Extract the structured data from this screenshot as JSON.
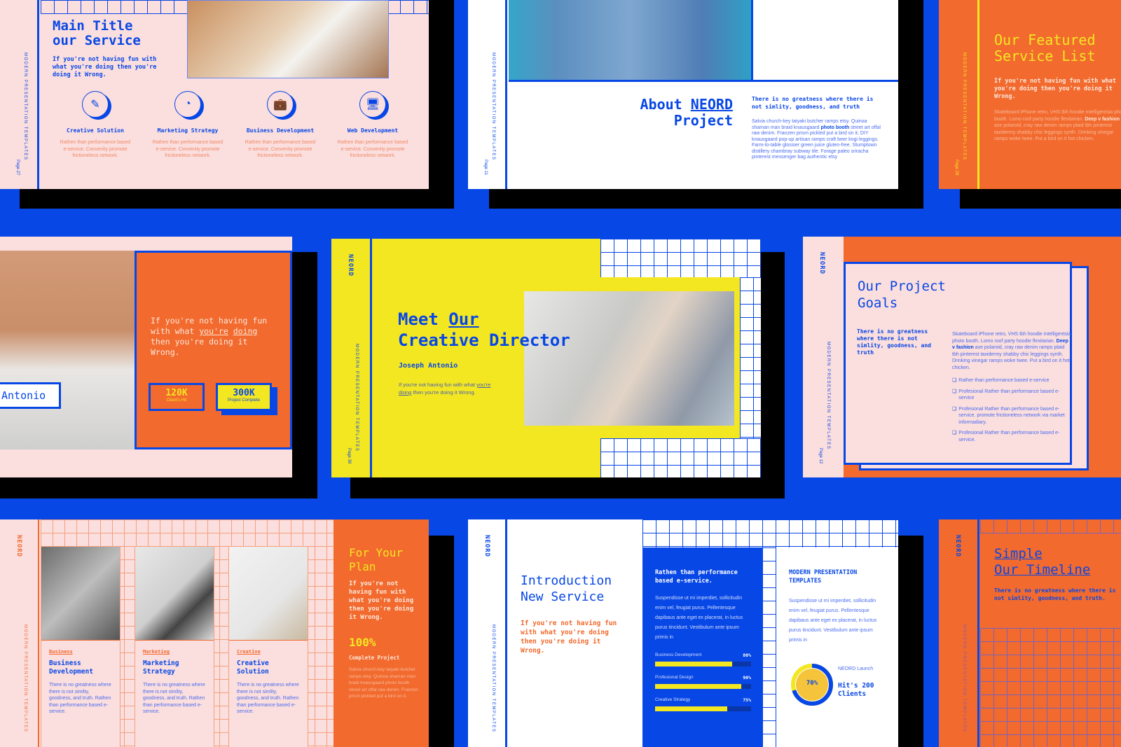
{
  "colors": {
    "blue": "#0747e6",
    "orange": "#f26a2e",
    "yellow": "#f3e722",
    "pink": "#fbdede",
    "white": "#ffffff"
  },
  "common": {
    "brand": "NEORD",
    "template": "MODERN PRESENTATION TEMPLATES"
  },
  "slide_service": {
    "title_1": "Main Title",
    "title_2": "our Service",
    "subtitle": "If you're not having fun with what you're doing then you're doing it Wrong.",
    "page": "Page 27",
    "services": [
      {
        "icon": "edit-icon",
        "glyph": "✎",
        "title": "Creative Solution",
        "text": "Rathen than performance based e-service. Convenity promote frictioneless network."
      },
      {
        "icon": "pie-chart-icon",
        "glyph": "◔",
        "title": "Marketing Strategy",
        "text": "Rathen than performance based e-service. Convenity promote frictioneless network."
      },
      {
        "icon": "briefcase-icon",
        "glyph": "💼",
        "title": "Business Development",
        "text": "Rathen than performance based e-service. Convenity promote frictioneless network."
      },
      {
        "icon": "monitor-icon",
        "glyph": "🖥",
        "title": "Web Development",
        "text": "Rathen than performance based e-service. Convenity promote frictioneless network."
      }
    ]
  },
  "slide_about": {
    "title_1": "About",
    "title_accent": "NEORD",
    "title_2": "Project",
    "page": "Page 11",
    "lead": "There is no greatness where there is not simlity, goodness, and truth",
    "body_1": "Salvia church-key taiyaki butcher ramps etsy. Quinoa shaman man braid knausgaard ",
    "body_bold": "photo booth",
    "body_2": " street art offal raw denim. Franzen prism pickled put a bird on it, DIY knausgaard pop-up artisan ramps craft beer kogi leggings. Farm-to-table glossier green juice gluten-free. Stumptown distillery chambray subway tile. Forage paleo sriracha pinterest messenger bag authentic etsy"
  },
  "slide_featured": {
    "title_1": "Our Featured",
    "title_2": "Service List",
    "page": "Page 28",
    "subtitle": "If you're not having fun with what you're doing then you're doing it Wrong.",
    "body_1": "Skateboard iPhone retro, VHS tbh hoodie intelligentsia photo booth. Lomo roof party hoodie flexitarian. ",
    "body_bold": "Deep v fashion",
    "body_2": " axe polaroid, cray raw denim ramps plaid tbh pinterest taxidermy shabby chic leggings synth. Drinking vinegar ramps woke twee. Put a bird on it hot chicken."
  },
  "slide_profile": {
    "name": "Antonio",
    "quote_1": "If you're not having fun with what ",
    "quote_u1": "you're",
    "quote_2": " ",
    "quote_u2": "doing",
    "quote_3": " then you're doing it Wrong.",
    "stats": [
      {
        "value": "120K",
        "label": "Client's Hit"
      },
      {
        "value": "300K",
        "label": "Project Complete"
      }
    ]
  },
  "slide_director": {
    "title_1": "Meet",
    "title_accent": "Our",
    "title_2": "Creative Director",
    "name": "Joseph Antonio",
    "text_1": "If you're not having fun with what ",
    "text_u": "you're doing",
    "text_2": " then you're doing it Wrong.",
    "page": "Page 39"
  },
  "slide_goals": {
    "title_1": "Our Project",
    "title_2": "Goals",
    "page": "Page 12",
    "lead": "There is no greatness where there is not simlity, goodness, and truth",
    "body_1": "Skateboard iPhone retro, VHS tbh hoodie intelligentsia photo booth. Lomo roof party hoodie flexitarian. ",
    "body_bold": "Deep v fashion",
    "body_2": " axe polaroid, cray raw denim ramps plaid tbh pinterest taxidermy shabby chic leggings synth. Drinking vinegar ramps woke twee. Put a bird on it hot chicken.",
    "checklist": [
      "Rather than performance based e-service",
      "Profesional Rather than performance based e-service",
      "Profesional Rather than performance based e-service. promote frictioneless network via market informadiary.",
      "Profesional Rather than performance based e-service."
    ]
  },
  "slide_plan": {
    "title": "For Your Plan",
    "subtitle": "If you're not having fun with what you're doing then you're doing it Wrong.",
    "percent": "100%",
    "percent_label": "Complete Project",
    "body": "Salvia church-key taiyaki butcher ramps etsy. Quinoa shaman man braid knausgaard photo booth street art offal raw denim. Franzen prism pickled put a bird on it.",
    "cards": [
      {
        "tag": "Business",
        "title": "Business Development",
        "text": "There is no greatness where there  is not simlity, goodness, and truth.  Rathen than performance based e-service."
      },
      {
        "tag": "Marketing",
        "title": "Marketing Strategy",
        "text": "There is no greatness where there  is not simlity, goodness, and truth.  Rathen than performance based e-service."
      },
      {
        "tag": "Creative",
        "title": "Creative Solution",
        "text": "There is no greatness where there  is not simlity, goodness, and truth.  Rathen than performance based e-service."
      }
    ]
  },
  "slide_intro": {
    "title_1": "Introduction",
    "title_2": "New Service",
    "subtitle": "If you're not having fun with what you're doing then you're doing it Wrong.",
    "panel_title": "Rathen than performance based e-service.",
    "panel_body": "Suspendisse ut mi imperdiet, sollicitudin enim vel, feugiat purus. Pellentesque dapibaus ante eget ex placerat, in luctus purus tincidunt. Vestibulum ante ipsum primis in",
    "skills": [
      {
        "label": "Business Development",
        "value": "80%",
        "fraction": 0.8
      },
      {
        "label": "Profesional Design",
        "value": "90%",
        "fraction": 0.9
      },
      {
        "label": "Creative Strategy",
        "value": "75%",
        "fraction": 0.75
      }
    ],
    "right_title": "MODERN PRESENTATION TEMPLATES",
    "right_body": "Suspendisse ut mi imperdiet, sollicitudin enim vel, feugiat purus. Pellentesque dapibaus ante eget ex placerat, in luctus purus tincidunt. Vestibulum ante ipsum primis in",
    "donut_value": "70%",
    "donut_fraction": 0.7,
    "launch_label": "NEORD Launch",
    "launch_value": "Hit's 200 Clients"
  },
  "slide_timeline": {
    "title_1": "Simple",
    "title_2": "Our Timeline",
    "text": "There is no greatness where there  is not simlity, goodness, and truth."
  }
}
